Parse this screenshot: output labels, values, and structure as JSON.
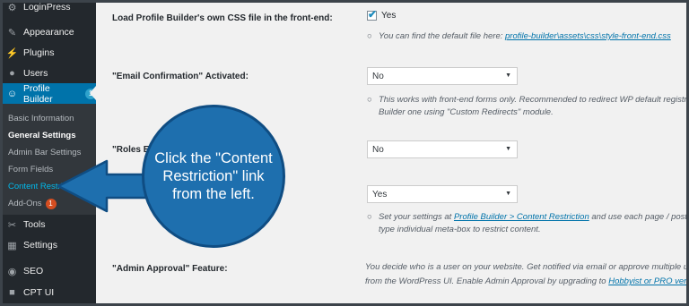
{
  "sidebar": {
    "top_item": "LoginPress",
    "items": [
      {
        "label": "Appearance",
        "icon": "paintbrush-icon"
      },
      {
        "label": "Plugins",
        "icon": "plug-icon"
      },
      {
        "label": "Users",
        "icon": "user-icon"
      },
      {
        "label": "Profile Builder",
        "icon": "profile-icon",
        "badge": "1"
      },
      {
        "label": "Tools",
        "icon": "wrench-icon"
      },
      {
        "label": "Settings",
        "icon": "settings-icon"
      },
      {
        "label": "SEO",
        "icon": "seo-icon"
      },
      {
        "label": "CPT UI",
        "icon": "cptui-icon"
      }
    ],
    "submenu": [
      {
        "label": "Basic Information"
      },
      {
        "label": "General Settings"
      },
      {
        "label": "Admin Bar Settings"
      },
      {
        "label": "Form Fields"
      },
      {
        "label": "Content Restriction"
      },
      {
        "label": "Add-Ons",
        "badge": "1"
      }
    ]
  },
  "settings": {
    "css_label": "Load Profile Builder's own CSS file in the front-end:",
    "css_checkbox_label": "Yes",
    "css_desc_prefix": "You can find the default file here: ",
    "css_desc_link": "profile-builder\\assets\\css\\style-front-end.css",
    "email_label": "\"Email Confirmation\" Activated:",
    "email_value": "No",
    "email_desc_line1": "This works with front-end forms only. Recommended to redirect WP default registrati",
    "email_desc_line2": "Builder one using \"Custom Redirects\" module.",
    "roles_label": "\"Roles Editor\"",
    "roles_value": "No",
    "restrict_value": "Yes",
    "restrict_desc_prefix": "Set your settings at ",
    "restrict_desc_link": "Profile Builder > Content Restriction",
    "restrict_desc_suffix": " and use each page / post / cu",
    "restrict_desc_line2": "type individual meta-box to restrict content.",
    "approval_label": "\"Admin Approval\" Feature:",
    "approval_line1": "You decide who is a user on your website. Get notified via email or approve multiple user",
    "approval_line2_prefix": "from the WordPress UI. Enable Admin Approval by upgrading to ",
    "approval_line2_link": "Hobbyist or PRO version"
  },
  "callout": {
    "text": "Click the \"Content Restriction\" link from the left.",
    "colors": {
      "fill": "#1e6fae",
      "border": "#0f4d83"
    }
  }
}
